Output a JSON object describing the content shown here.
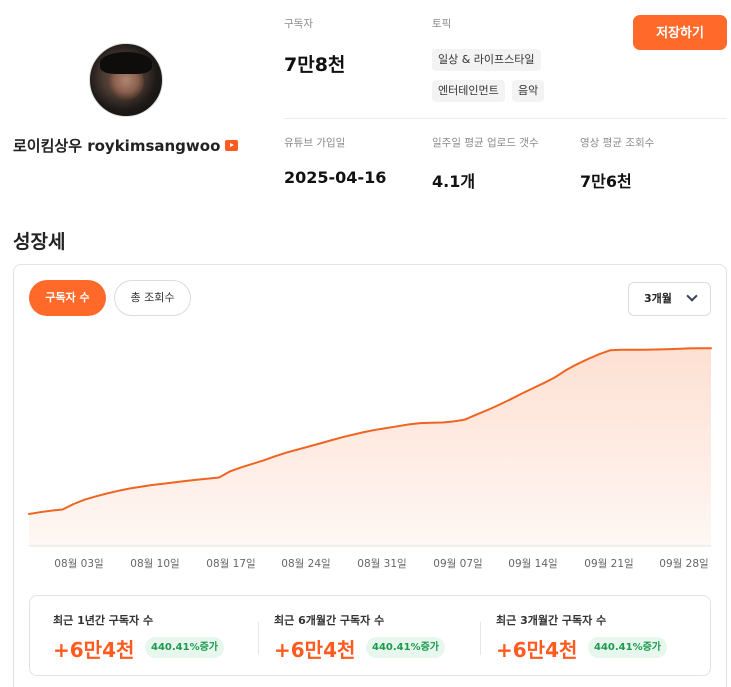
{
  "profile": {
    "channel_name": "로이킴상우 roykimsangwoo",
    "platform_icon": "youtube-icon"
  },
  "stats": {
    "subscribers_label": "구독자",
    "subscribers_value": "7만8천",
    "topics_label": "토픽",
    "topics": [
      "일상 & 라이프스타일",
      "엔터테인먼트",
      "음악"
    ],
    "joined_label": "유튜브 가입일",
    "joined_value": "2025-04-16",
    "weekly_uploads_label": "일주일 평균 업로드 갯수",
    "weekly_uploads_value": "4.1개",
    "avg_views_label": "영상 평균 조회수",
    "avg_views_value": "7만6천"
  },
  "actions": {
    "save_label": "저장하기"
  },
  "growth": {
    "title": "성장세",
    "tabs": [
      "구독자 수",
      "총 조회수"
    ],
    "active_tab": "구독자 수",
    "period": "3개월"
  },
  "colors": {
    "accent": "#ff6a2b",
    "line": "#f06421",
    "area_top": "#fde0d2",
    "badge_bg": "#e8f7ee",
    "badge_text": "#1c9a4e"
  },
  "chart_data": {
    "type": "area",
    "x_tick_labels": [
      "08월 03일",
      "08월 10일",
      "08월 17일",
      "08월 24일",
      "08월 31일",
      "09월 07일",
      "09월 14일",
      "09월 21일",
      "09월 28일"
    ],
    "x": [
      "07월 31일",
      "08월 01일",
      "08월 02일",
      "08월 03일",
      "08월 04일",
      "08월 05일",
      "08월 06일",
      "08월 07일",
      "08월 08일",
      "08월 09일",
      "08월 10일",
      "08월 11일",
      "08월 12일",
      "08월 13일",
      "08월 14일",
      "08월 15일",
      "08월 16일",
      "08월 17일",
      "08월 18일",
      "08월 19일",
      "08월 20일",
      "08월 21일",
      "08월 22일",
      "08월 23일",
      "08월 24일",
      "08월 25일",
      "08월 26일",
      "08월 27일",
      "08월 28일",
      "08월 29일",
      "08월 30日",
      "08월 31일",
      "09월 01일",
      "09월 02일",
      "09월 03일",
      "09월 04일",
      "09월 05일",
      "09월 06일",
      "09월 07일",
      "09월 08일",
      "09월 09일",
      "09월 10일",
      "09월 11일",
      "09월 12일",
      "09월 13일",
      "09월 14일",
      "09월 15일",
      "09월 16일",
      "09월 17일",
      "09월 18일",
      "09월 19일",
      "09월 20일",
      "09월 21일",
      "09월 22일",
      "09월 23일",
      "09월 24일",
      "09월 25일",
      "09월 26일",
      "09월 27일",
      "09월 28일",
      "09월 29일",
      "09월 30일"
    ],
    "series": [
      {
        "values": [
          14.5,
          15.3,
          16.0,
          16.5,
          19.0,
          21.0,
          22.5,
          23.8,
          25.0,
          26.0,
          26.8,
          27.6,
          28.2,
          28.8,
          29.4,
          30.0,
          30.5,
          31.0,
          33.8,
          35.6,
          37.2,
          38.8,
          40.6,
          42.2,
          43.6,
          45.0,
          46.4,
          47.8,
          49.2,
          50.4,
          51.6,
          52.6,
          53.4,
          54.2,
          55.0,
          55.6,
          55.8,
          55.9,
          56.4,
          57.2,
          59.4,
          61.5,
          63.8,
          66.2,
          68.8,
          71.2,
          73.6,
          76.2,
          79.5,
          82.2,
          84.6,
          86.8,
          88.6,
          88.8,
          88.8,
          88.8,
          88.9,
          89.0,
          89.2,
          89.4,
          89.5,
          89.5
        ]
      }
    ],
    "grid": false,
    "legend": "none"
  },
  "summary": [
    {
      "label": "최근 1년간 구독자 수",
      "value": "+6만4천",
      "badge": "440.41%증가"
    },
    {
      "label": "최근 6개월간 구독자 수",
      "value": "+6만4천",
      "badge": "440.41%증가"
    },
    {
      "label": "최근 3개월간 구독자 수",
      "value": "+6만4천",
      "badge": "440.41%증가"
    }
  ]
}
